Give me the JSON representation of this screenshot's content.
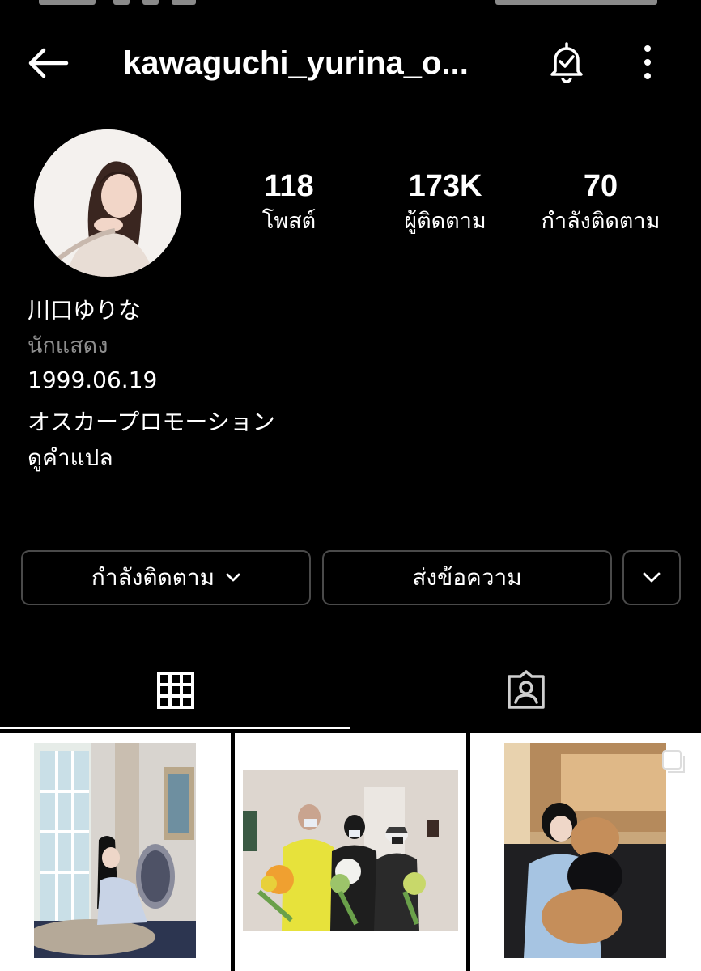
{
  "header": {
    "username": "kawaguchi_yurina_o..."
  },
  "stats": [
    {
      "value": "118",
      "label": "โพสต์"
    },
    {
      "value": "173K",
      "label": "ผู้ติดตาม"
    },
    {
      "value": "70",
      "label": "กำลังติดตาม"
    }
  ],
  "bio": {
    "name": "川口ゆりな",
    "category": "นักแสดง",
    "lines": [
      "1999.06.19",
      "オスカープロモーション",
      "ดูคำแปล"
    ]
  },
  "buttons": {
    "following": "กำลังติดตาม",
    "message": "ส่งข้อความ"
  },
  "icons": {
    "back": "arrow-left-icon",
    "bell": "notification-bell-icon",
    "more": "more-vertical-icon",
    "grid": "grid-icon",
    "tagged": "tagged-person-icon"
  },
  "colors": {
    "background": "#000000",
    "text": "#ffffff",
    "secondary_text": "#8e8e8e",
    "button_border": "#4a4a4a"
  }
}
